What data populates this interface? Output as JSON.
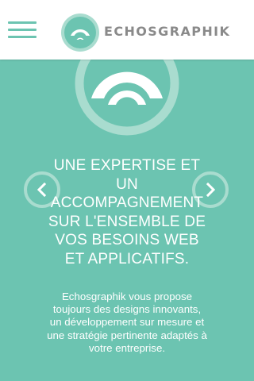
{
  "header": {
    "brand_name": "ECHOSGRAPHIK",
    "menu_icon": "hamburger-menu-icon",
    "logo_icon": "echosgraphik-logo-icon"
  },
  "hero": {
    "logo_icon": "echosgraphik-logo-icon",
    "headline": "UNE EXPERTISE ET UN ACCOMPAGNEMENT SUR L'ENSEMBLE DE VOS BESOINS WEB ET APPLICATIFS.",
    "description": "Echosgraphik vous propose toujours des designs innovants, un développement sur mesure et une stratégie pertinente adaptés à votre entreprise.",
    "prev_icon": "chevron-left-icon",
    "next_icon": "chevron-right-icon"
  },
  "colors": {
    "accent": "#6cc4b1",
    "accent_light": "#a9dccf",
    "header_bg": "#ffffff",
    "brand_text": "#8a8a8a",
    "text": "#ffffff"
  }
}
